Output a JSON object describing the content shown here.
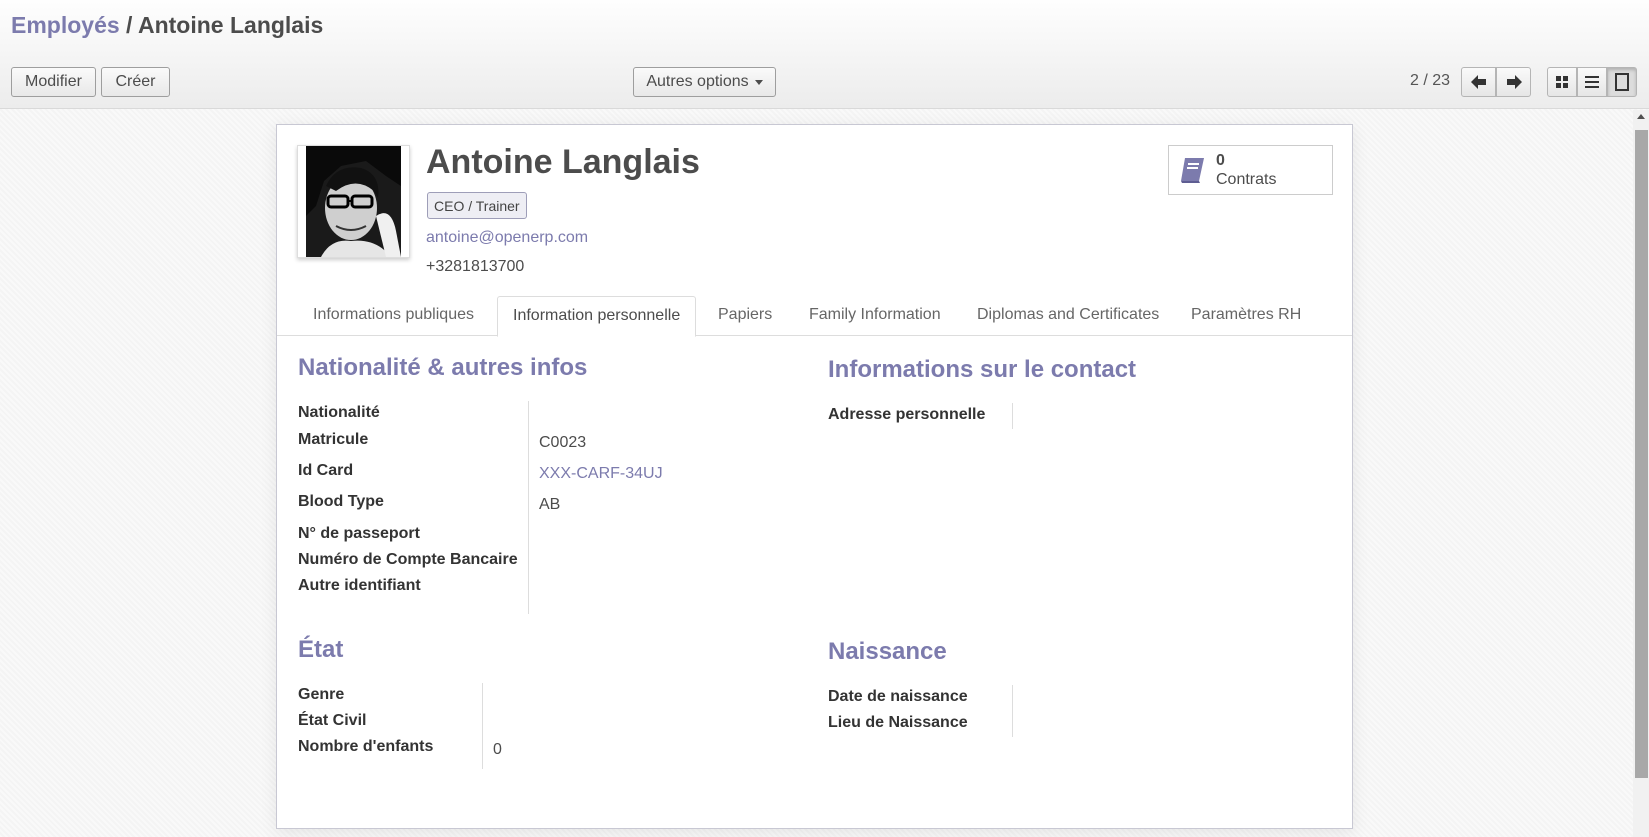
{
  "breadcrumb": {
    "parent": "Employés",
    "separator": " / ",
    "current": "Antoine Langlais"
  },
  "toolbar": {
    "edit_label": "Modifier",
    "create_label": "Créer",
    "more_options_label": "Autres options"
  },
  "pager": {
    "value": "2 / 23"
  },
  "views": [
    "kanban-icon",
    "list-icon",
    "form-icon"
  ],
  "employee": {
    "name": "Antoine Langlais",
    "job_tag": "CEO / Trainer",
    "email": "antoine@openerp.com",
    "phone": "+3281813700"
  },
  "contracts_button": {
    "count": "0",
    "label": "Contrats"
  },
  "tabs": [
    {
      "label": "Informations publiques",
      "active": false
    },
    {
      "label": "Information personnelle",
      "active": true
    },
    {
      "label": "Papiers",
      "active": false
    },
    {
      "label": "Family Information",
      "active": false
    },
    {
      "label": "Diplomas and Certificates",
      "active": false
    },
    {
      "label": "Paramètres RH",
      "active": false
    }
  ],
  "nationality_section": {
    "title": "Nationalité & autres infos",
    "fields": [
      {
        "label": "Nationalité",
        "value": ""
      },
      {
        "label": "Matricule",
        "value": "C0023"
      },
      {
        "label": "Id Card",
        "value": "XXX-CARF-34UJ"
      },
      {
        "label": "Blood Type",
        "value": "AB"
      },
      {
        "label": "N° de passeport",
        "value": ""
      },
      {
        "label": "Numéro de Compte Bancaire",
        "value": ""
      },
      {
        "label": "Autre identifiant",
        "value": ""
      }
    ]
  },
  "contact_section": {
    "title": "Informations sur le contact",
    "fields": [
      {
        "label": "Adresse personnelle",
        "value": ""
      }
    ]
  },
  "status_section": {
    "title": "État",
    "fields": [
      {
        "label": "Genre",
        "value": ""
      },
      {
        "label": "État Civil",
        "value": ""
      },
      {
        "label": "Nombre d'enfants",
        "value": "0"
      }
    ]
  },
  "birth_section": {
    "title": "Naissance",
    "fields": [
      {
        "label": "Date de naissance",
        "value": ""
      },
      {
        "label": "Lieu de Naissance",
        "value": ""
      }
    ]
  },
  "colors": {
    "accent": "#7c7bad",
    "text": "#4c4c4c"
  }
}
